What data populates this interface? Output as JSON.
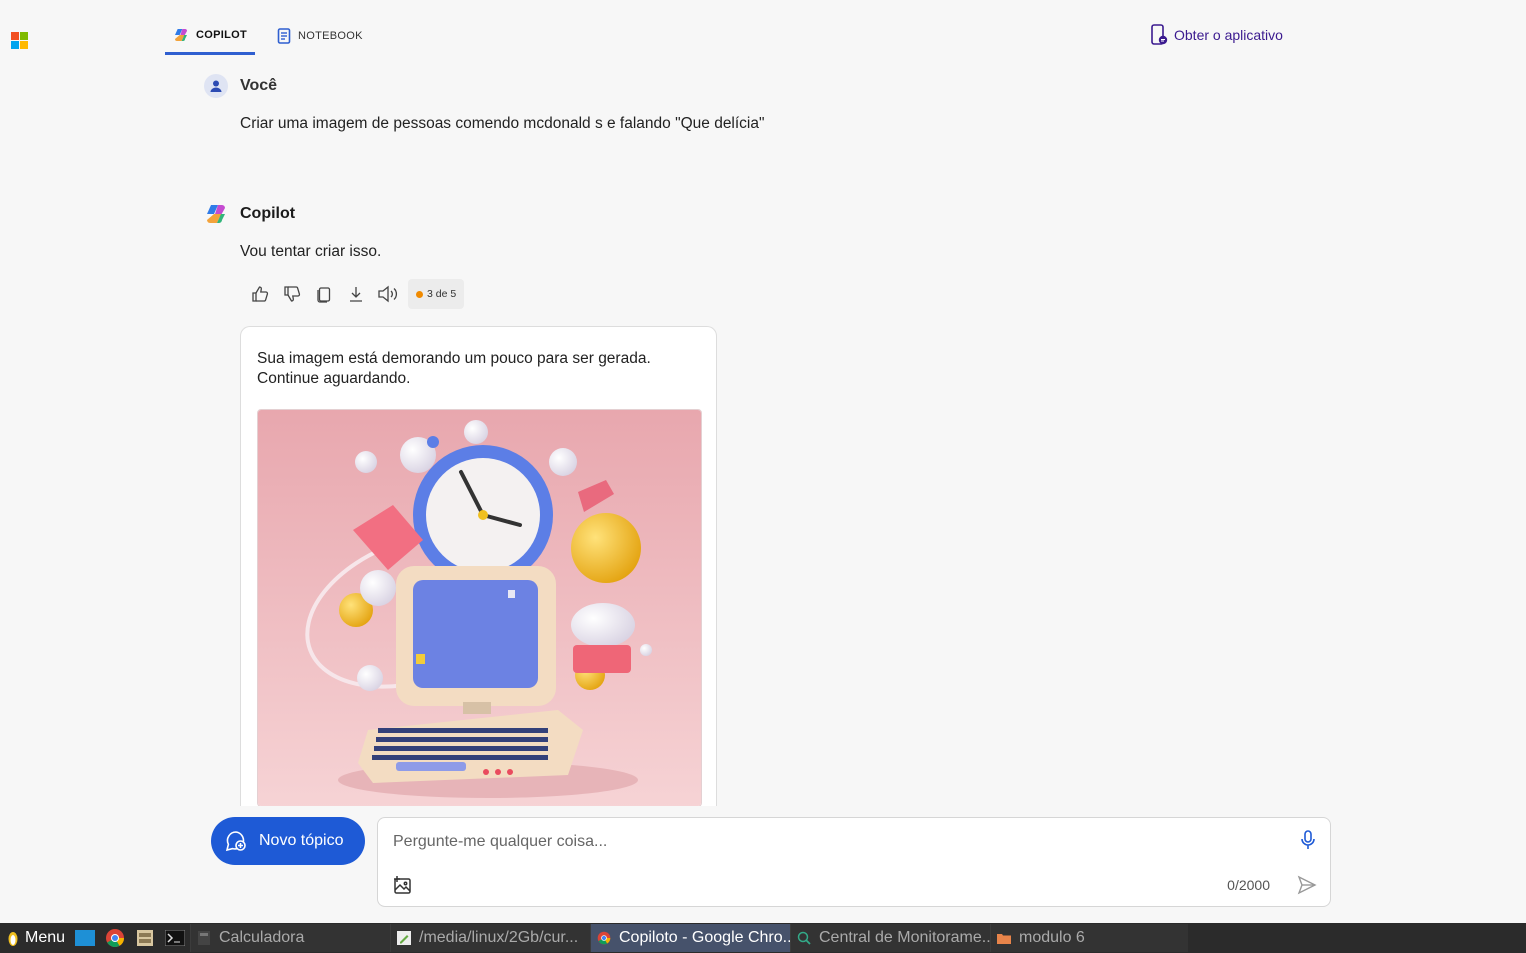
{
  "nav": {
    "tabs": [
      {
        "label": "COPILOT",
        "icon": "copilot-logo-icon",
        "active": true
      },
      {
        "label": "NOTEBOOK",
        "icon": "notebook-icon",
        "active": false
      }
    ],
    "get_app_label": "Obter o aplicativo"
  },
  "conversation": {
    "user": {
      "name": "Você",
      "message": "Criar uma imagem de pessoas comendo mcdonald s  e falando \"Que delícia\""
    },
    "assistant": {
      "name": "Copilot",
      "message": "Vou tentar criar isso.",
      "counter": "3 de 5",
      "card_text": "Sua imagem está demorando um pouco para ser gerada. Continue aguardando."
    }
  },
  "composer": {
    "new_topic_label": "Novo tópico",
    "placeholder": "Pergunte-me qualquer coisa...",
    "char_count": "0/2000"
  },
  "taskbar": {
    "menu_label": "Menu",
    "tasks": [
      {
        "label": "Calculadora",
        "active": false
      },
      {
        "label": "/media/linux/2Gb/cur...",
        "active": false
      },
      {
        "label": "Copiloto - Google Chro...",
        "active": true
      },
      {
        "label": "Central de Monitorame...",
        "active": false
      },
      {
        "label": "modulo 6",
        "active": false
      }
    ]
  },
  "colors": {
    "accent": "#1e5ad6",
    "get_app": "#3b1a8f",
    "counter_dot": "#f08a00",
    "taskbar": "#2b2b2b"
  }
}
